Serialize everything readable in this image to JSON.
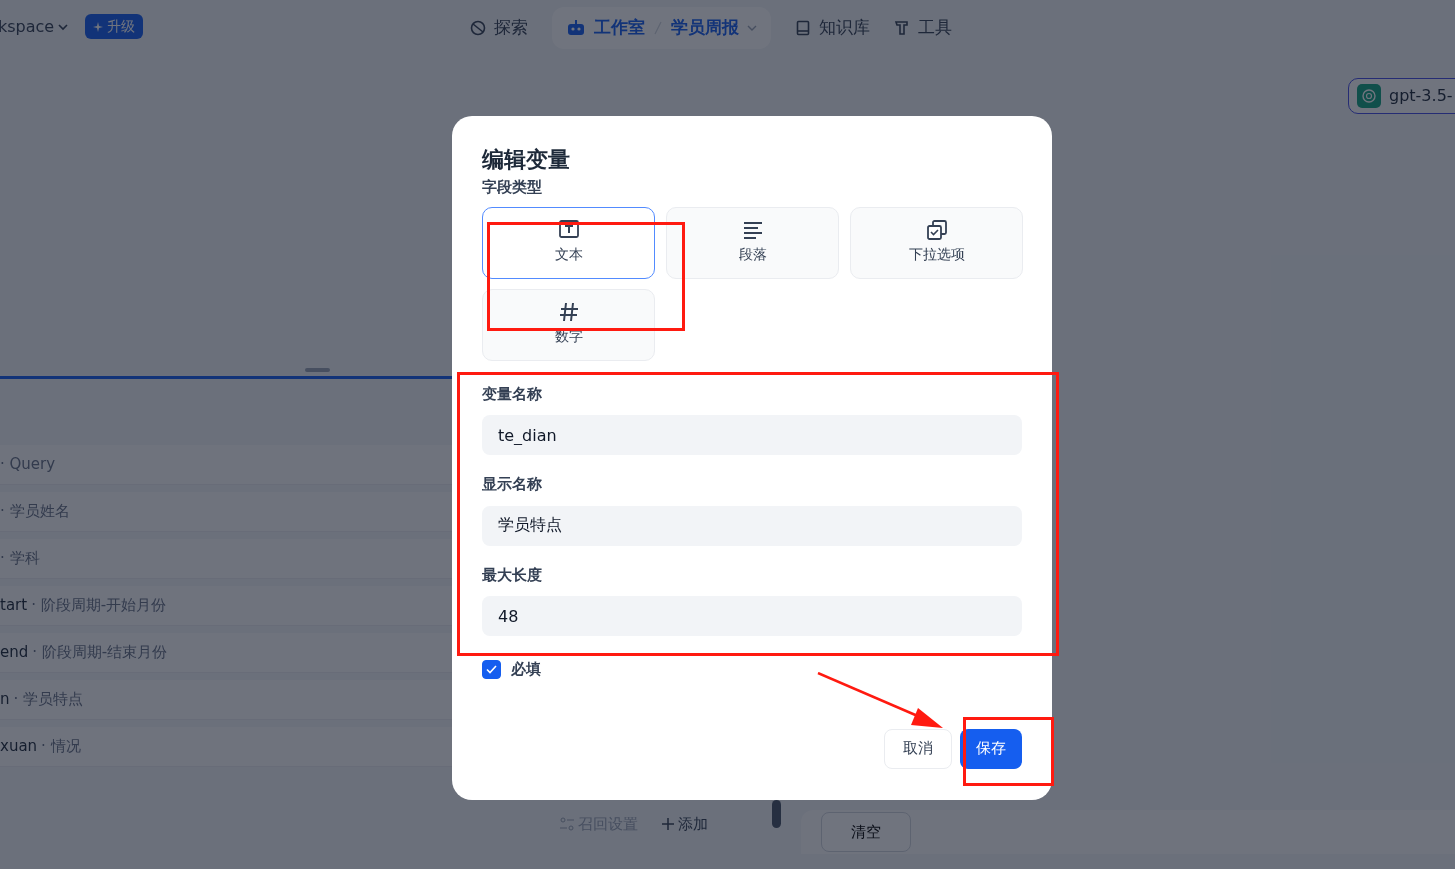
{
  "header": {
    "workspace": "kspace",
    "upgrade": "升级",
    "nav": [
      {
        "kind": "link",
        "label": "探索"
      },
      {
        "kind": "studio",
        "label": "工作室",
        "app": "学员周报"
      },
      {
        "kind": "link",
        "label": "知识库"
      },
      {
        "kind": "link",
        "label": "工具"
      }
    ]
  },
  "model": {
    "label": "gpt-3.5-"
  },
  "variables": [
    {
      "desc": "· Query"
    },
    {
      "desc": "· 学员姓名"
    },
    {
      "desc": "· 学科"
    },
    {
      "name": "tart",
      "desc": "· 阶段周期-开始月份"
    },
    {
      "name": "end",
      "desc": "· 阶段周期-结束月份"
    },
    {
      "name": "n",
      "desc": "· 学员特点"
    },
    {
      "name": "xuan",
      "desc": "· 情况"
    }
  ],
  "panel_actions": {
    "retrieval": "召回设置",
    "add": "添加"
  },
  "clear_button": "清空",
  "modal": {
    "title": "编辑变量",
    "type_label": "字段类型",
    "types": [
      {
        "label": "文本",
        "selected": true
      },
      {
        "label": "段落",
        "selected": false
      },
      {
        "label": "下拉选项",
        "selected": false
      },
      {
        "label": "数字",
        "selected": false
      }
    ],
    "fields": [
      {
        "label": "变量名称",
        "value": "te_dian"
      },
      {
        "label": "显示名称",
        "value": "学员特点"
      },
      {
        "label": "最大长度",
        "value": "48"
      }
    ],
    "required": {
      "label": "必填",
      "checked": true
    },
    "cancel": "取消",
    "save": "保存"
  },
  "annotations": [
    {
      "kind": "box"
    },
    {
      "kind": "box"
    },
    {
      "kind": "box"
    },
    {
      "kind": "arrow"
    }
  ]
}
